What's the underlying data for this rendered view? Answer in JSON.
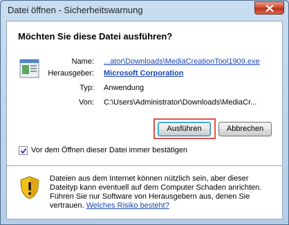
{
  "window": {
    "title": "Datei öffnen - Sicherheitswarnung"
  },
  "dialog": {
    "question": "Möchten Sie diese Datei ausführen?",
    "fields": [
      {
        "label": "Name:",
        "value": "...ator\\Downloads\\MediaCreationTool1909.exe"
      },
      {
        "label": "Herausgeber:",
        "value": "Microsoft Corporation"
      },
      {
        "label": "Typ:",
        "value": "Anwendung"
      },
      {
        "label": "Von:",
        "value": "C:\\Users\\Administrator\\Downloads\\MediaCr..."
      }
    ],
    "run_button": "Ausführen",
    "cancel_button": "Abbrechen",
    "checkbox_label": "Vor dem Öffnen dieser Datei immer bestätigen",
    "checkbox_checked": true
  },
  "warning": {
    "text": "Dateien aus dem Internet können nützlich sein, aber dieser Dateityp kann eventuell auf dem Computer Schaden anrichten. Führen Sie nur Software von Herausgebern aus, denen Sie vertrauen.",
    "link": "Welches Risiko besteht?"
  },
  "colors": {
    "highlight": "#d9534a",
    "link": "#1b45b3",
    "close_button": "#c0321a"
  },
  "icons": {
    "file": "application-file-icon",
    "warning": "security-warning-shield-icon",
    "close": "close-icon"
  }
}
